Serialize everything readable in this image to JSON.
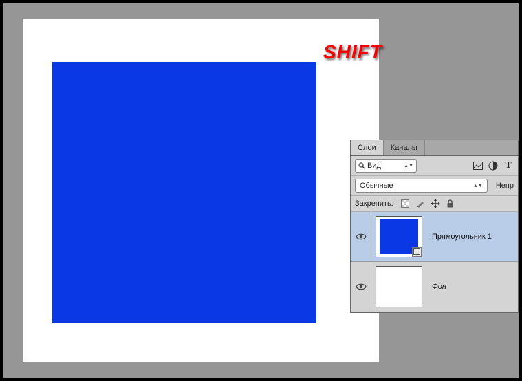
{
  "hint": "SHIFT",
  "panel": {
    "tabs": {
      "layers": "Слои",
      "channels": "Каналы"
    },
    "search_label": "Вид",
    "blend_mode": "Обычные",
    "opacity_label": "Непр",
    "lock_label": "Закрепить:"
  },
  "layers": [
    {
      "name": "Прямоугольник 1"
    },
    {
      "name": "Фон"
    }
  ]
}
